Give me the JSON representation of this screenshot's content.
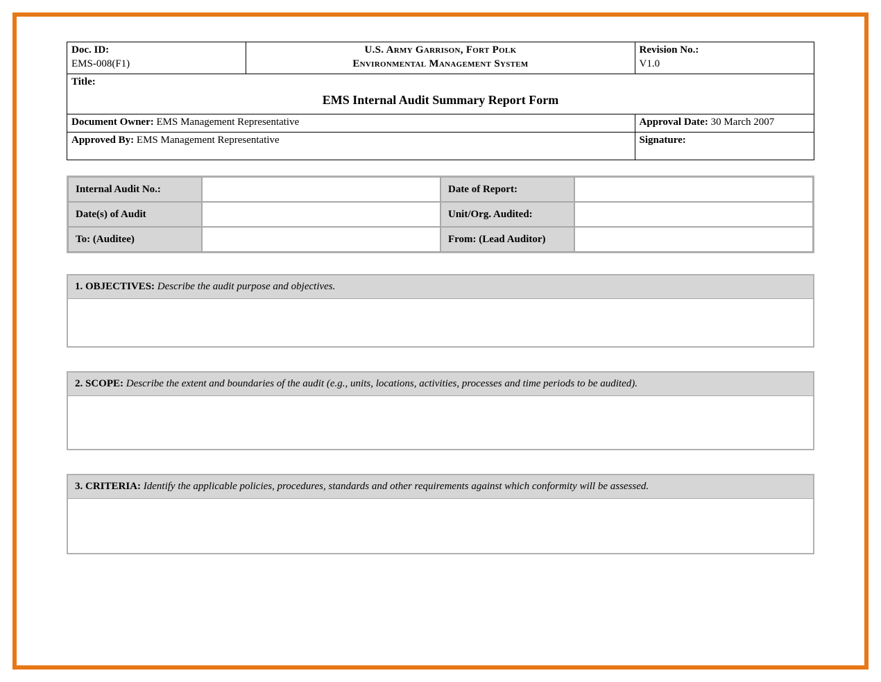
{
  "meta": {
    "docIdLabel": "Doc. ID:",
    "docId": "EMS-008(F1)",
    "orgLine1": "U.S. Army Garrison, Fort Polk",
    "orgLine2": "Environmental Management System",
    "revLabel": "Revision No.:",
    "rev": "V1.0",
    "titleLabel": "Title:",
    "formTitle": "EMS Internal Audit Summary Report Form",
    "ownerLabel": "Document Owner:",
    "owner": " EMS Management Representative",
    "approvalDateLabel": "Approval Date:",
    "approvalDate": " 30 March 2007",
    "approvedByLabel": "Approved By:",
    "approvedBy": " EMS Management Representative",
    "signatureLabel": "Signature:"
  },
  "info": {
    "auditNoLabel": "Internal Audit No.:",
    "dateReportLabel": "Date of Report:",
    "datesAuditLabel": "Date(s) of Audit",
    "unitLabel": "Unit/Org. Audited:",
    "toLabel": "To: (Auditee)",
    "fromLabel": "From: (Lead Auditor)"
  },
  "sections": {
    "objectives": {
      "num": "1.",
      "name": "  OBJECTIVES:",
      "desc": "  Describe the audit purpose and objectives."
    },
    "scope": {
      "num": "2.",
      "name": "  SCOPE:",
      "desc": "  Describe the extent and boundaries of the audit (e.g., units, locations, activities, processes and time periods to be audited)."
    },
    "criteria": {
      "num": "3.",
      "name": "  CRITERIA:",
      "desc": "  Identify the applicable policies, procedures, standards and other requirements against which conformity will be assessed."
    }
  }
}
